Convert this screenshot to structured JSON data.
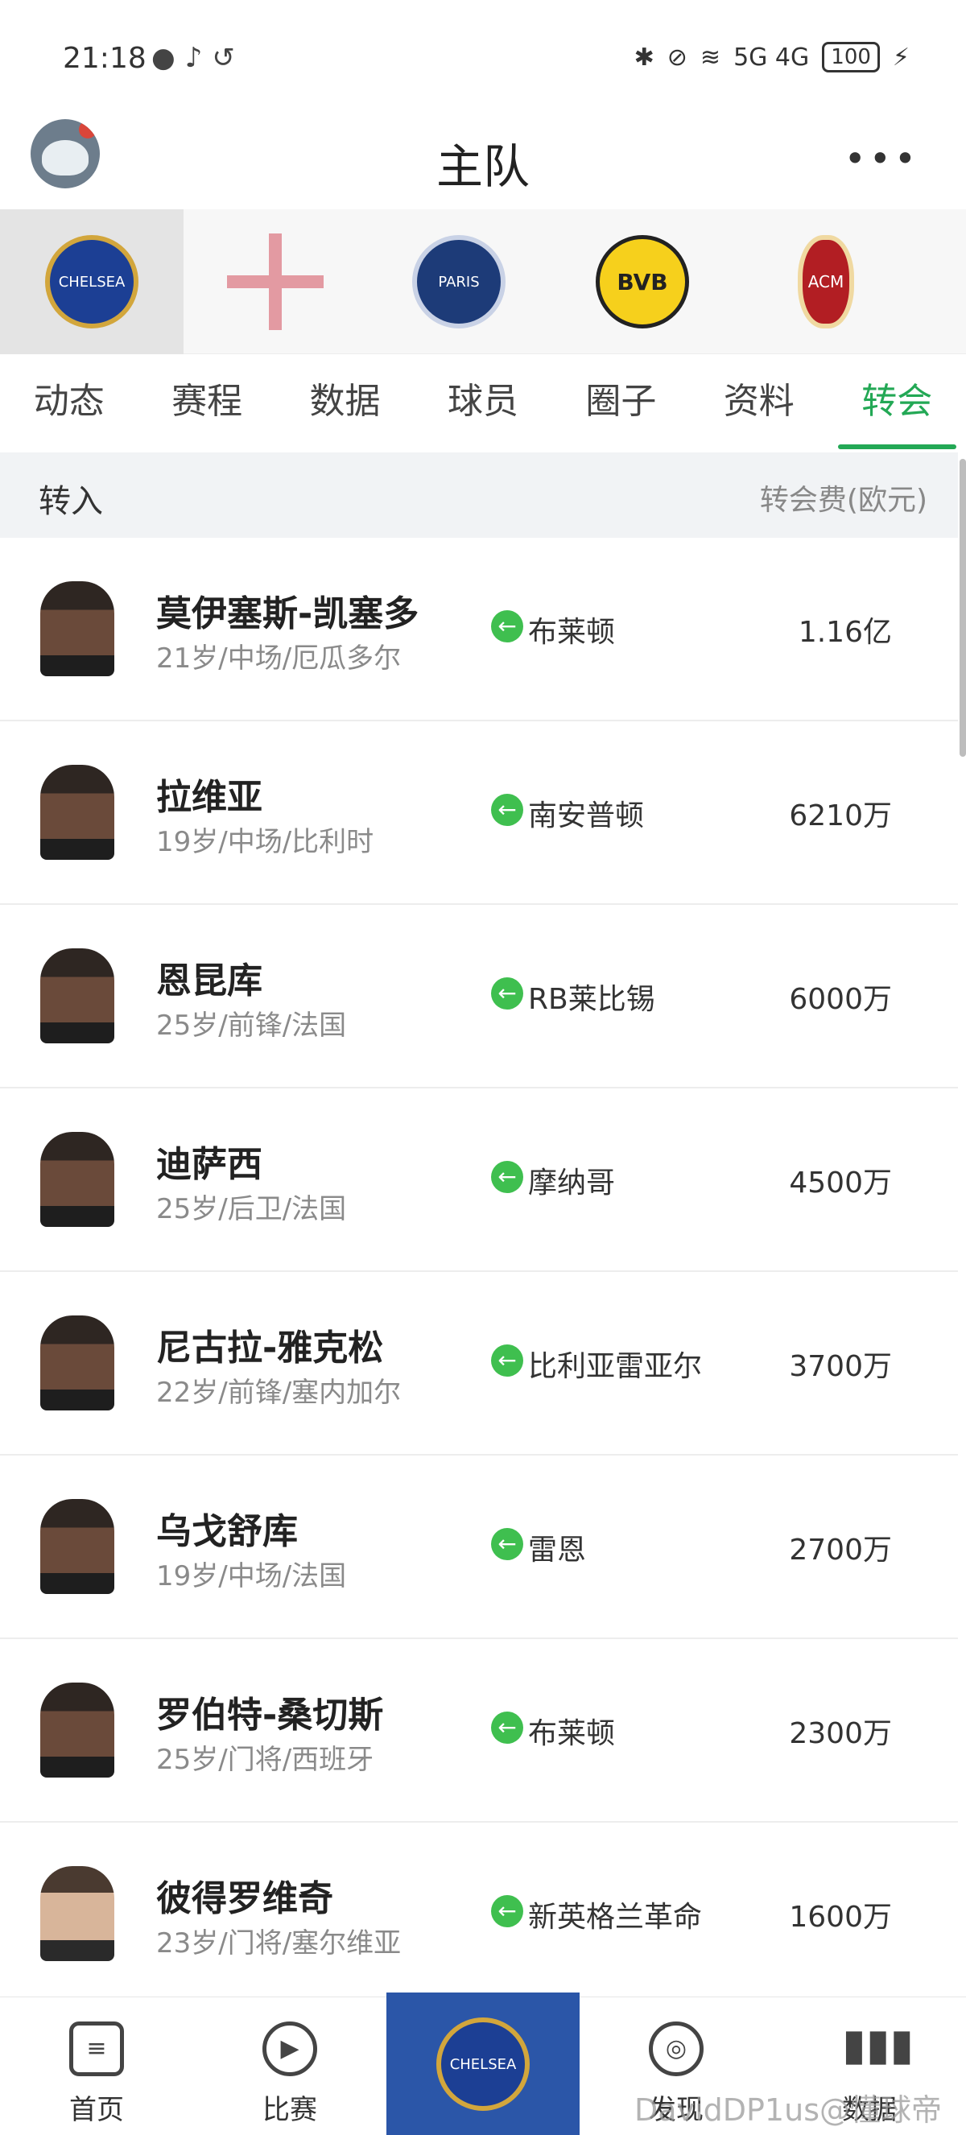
{
  "status_bar": {
    "time": "21:18",
    "network": "5G 4G",
    "battery": "100"
  },
  "header": {
    "title": "主队",
    "more": "•••"
  },
  "teams": [
    {
      "name": "chelsea",
      "badge_text": "CHELSEA"
    },
    {
      "name": "england",
      "badge_text": ""
    },
    {
      "name": "psg",
      "badge_text": "PARIS"
    },
    {
      "name": "bvb",
      "badge_text": "BVB"
    },
    {
      "name": "ac-milan",
      "badge_text": "ACM"
    }
  ],
  "tabs": [
    {
      "label": "动态"
    },
    {
      "label": "赛程"
    },
    {
      "label": "数据"
    },
    {
      "label": "球员"
    },
    {
      "label": "圈子"
    },
    {
      "label": "资料"
    },
    {
      "label": "转会",
      "active": true
    }
  ],
  "section": {
    "title": "转入",
    "fee_header": "转会费(欧元)"
  },
  "transfers": [
    {
      "name": "莫伊塞斯-凯塞多",
      "meta": "21岁/中场/厄瓜多尔",
      "from": "布莱顿",
      "fee": "1.16亿"
    },
    {
      "name": "拉维亚",
      "meta": "19岁/中场/比利时",
      "from": "南安普顿",
      "fee": "6210万"
    },
    {
      "name": "恩昆库",
      "meta": "25岁/前锋/法国",
      "from": "RB莱比锡",
      "fee": "6000万"
    },
    {
      "name": "迪萨西",
      "meta": "25岁/后卫/法国",
      "from": "摩纳哥",
      "fee": "4500万"
    },
    {
      "name": "尼古拉-雅克松",
      "meta": "22岁/前锋/塞内加尔",
      "from": "比利亚雷亚尔",
      "fee": "3700万"
    },
    {
      "name": "乌戈舒库",
      "meta": "19岁/中场/法国",
      "from": "雷恩",
      "fee": "2700万"
    },
    {
      "name": "罗伯特-桑切斯",
      "meta": "25岁/门将/西班牙",
      "from": "布莱顿",
      "fee": "2300万"
    },
    {
      "name": "彼得罗维奇",
      "meta": "23岁/门将/塞尔维亚",
      "from": "新英格兰革命",
      "fee": "1600万"
    }
  ],
  "bottom_nav": [
    {
      "label": "首页",
      "icon": "home-doc-icon"
    },
    {
      "label": "比赛",
      "icon": "play-icon"
    },
    {
      "label": "",
      "icon": "chelsea-badge-icon"
    },
    {
      "label": "发现",
      "icon": "discover-planet-icon"
    },
    {
      "label": "数据",
      "icon": "bar-chart-icon"
    }
  ],
  "watermark": "DavidDP1us@懂球帝"
}
